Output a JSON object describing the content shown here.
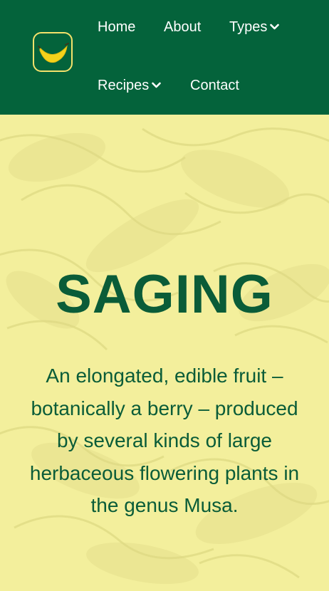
{
  "nav": {
    "logo_icon": "banana-icon",
    "items": [
      {
        "label": "Home",
        "has_dropdown": false
      },
      {
        "label": "About",
        "has_dropdown": false
      },
      {
        "label": "Types",
        "has_dropdown": true
      },
      {
        "label": "Recipes",
        "has_dropdown": true
      },
      {
        "label": "Contact",
        "has_dropdown": false
      }
    ]
  },
  "hero": {
    "title": "SAGING",
    "description": "An elongated, edible fruit – botanically a berry – produced by several kinds of large herbaceous flowering plants in the genus Musa."
  },
  "colors": {
    "nav_background": "#04633b",
    "accent": "#f5d21b",
    "hero_background": "#f3ef9c",
    "hero_text": "#0a5c38"
  }
}
